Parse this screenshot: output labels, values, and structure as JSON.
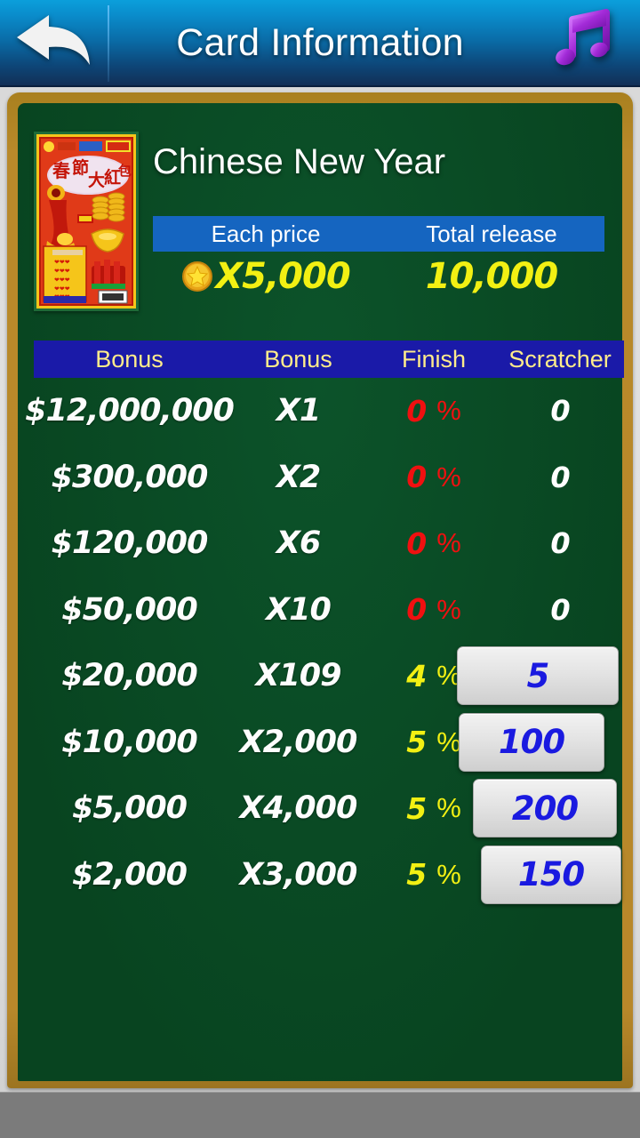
{
  "header": {
    "title": "Card Information",
    "back_icon": "back-arrow-icon",
    "music_icon": "music-note-icon"
  },
  "card": {
    "name": "Chinese New Year",
    "thumbnail_alt": "chinese-new-year-scratch-card",
    "summary_headers": {
      "each_price": "Each price",
      "total_release": "Total release"
    },
    "each_price_value": "X5,000",
    "each_price_icon": "star-coin-icon",
    "total_release_value": "10,000"
  },
  "table": {
    "headers": [
      "Bonus",
      "Bonus",
      "Finish",
      "Scratcher"
    ],
    "percent_symbol": "%",
    "rows": [
      {
        "amount": "$12,000,000",
        "multiplier": "X1",
        "finish": "0",
        "scratcher": "0",
        "is_button": false,
        "finish_color": "red"
      },
      {
        "amount": "$300,000",
        "multiplier": "X2",
        "finish": "0",
        "scratcher": "0",
        "is_button": false,
        "finish_color": "red"
      },
      {
        "amount": "$120,000",
        "multiplier": "X6",
        "finish": "0",
        "scratcher": "0",
        "is_button": false,
        "finish_color": "red"
      },
      {
        "amount": "$50,000",
        "multiplier": "X10",
        "finish": "0",
        "scratcher": "0",
        "is_button": false,
        "finish_color": "red"
      },
      {
        "amount": "$20,000",
        "multiplier": "X109",
        "finish": "4",
        "scratcher": "5",
        "is_button": true,
        "finish_color": "yellow"
      },
      {
        "amount": "$10,000",
        "multiplier": "X2,000",
        "finish": "5",
        "scratcher": "100",
        "is_button": true,
        "finish_color": "yellow"
      },
      {
        "amount": "$5,000",
        "multiplier": "X4,000",
        "finish": "5",
        "scratcher": "200",
        "is_button": true,
        "finish_color": "yellow"
      },
      {
        "amount": "$2,000",
        "multiplier": "X3,000",
        "finish": "5",
        "scratcher": "150",
        "is_button": true,
        "finish_color": "yellow"
      }
    ]
  },
  "colors": {
    "header_top": "#0b9fdb",
    "header_bottom": "#122f56",
    "board_green": "#0a4a25",
    "frame_gold": "#b8882a",
    "summary_blue": "#1565c0",
    "table_header_blue": "#1a1aa8",
    "table_header_text": "#ffec8b",
    "value_yellow": "#f2f013",
    "finish_red": "#f01010",
    "button_text_blue": "#1a1ae0"
  }
}
